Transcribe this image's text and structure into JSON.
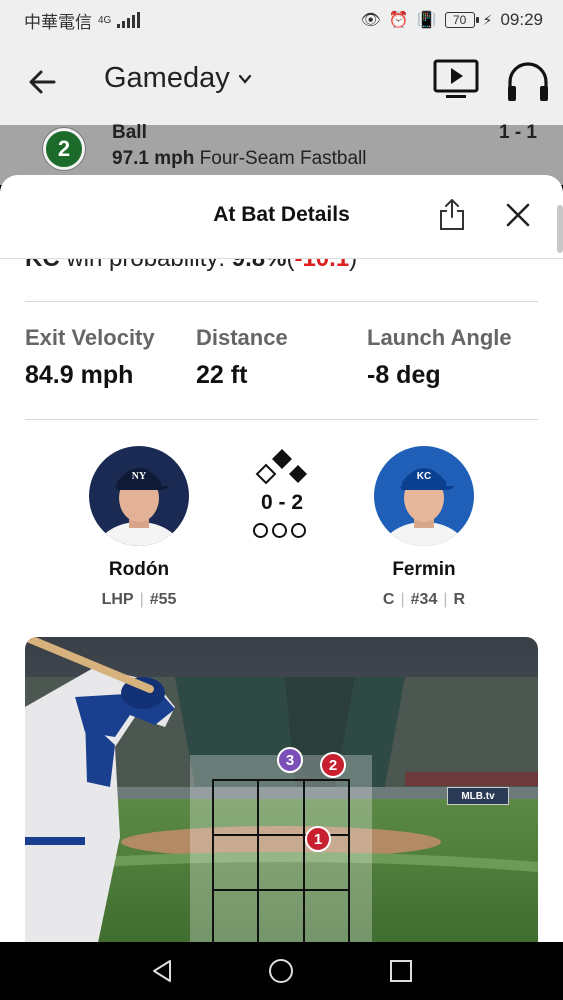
{
  "status_bar": {
    "carrier": "中華電信",
    "network": "4G",
    "battery": "70",
    "time": "09:29"
  },
  "app_bar": {
    "title": "Gameday"
  },
  "current_pitch": {
    "number": "2",
    "result": "Ball",
    "count": "1 - 1",
    "speed": "97.1 mph",
    "pitch_type": "Four-Seam Fastball"
  },
  "sheet": {
    "title": "At Bat Details",
    "win_prob_team": "KC",
    "win_prob_label": "win probability:",
    "win_prob_value": "9.8%",
    "win_prob_change": "-10.1"
  },
  "stats": [
    {
      "label": "Exit Velocity",
      "value": "84.9 mph"
    },
    {
      "label": "Distance",
      "value": "22 ft"
    },
    {
      "label": "Launch Angle",
      "value": "-8 deg"
    }
  ],
  "matchup": {
    "pitcher": {
      "name": "Rodón",
      "position": "LHP",
      "number": "#55",
      "team_mark": "NY"
    },
    "batter": {
      "name": "Fermin",
      "position": "C",
      "number": "#34",
      "bats": "R",
      "team_mark": "KC"
    },
    "count": "0 - 2"
  },
  "strike_zone": {
    "pitches": [
      {
        "number": "1",
        "color": "#c8202e"
      },
      {
        "number": "2",
        "color": "#c8202e"
      },
      {
        "number": "3",
        "color": "#7b4fb8"
      }
    ],
    "broadcast_logo": "MLB.tv"
  },
  "colors": {
    "accent_negative": "#e02020",
    "ball_badge": "#1d6b2a"
  }
}
